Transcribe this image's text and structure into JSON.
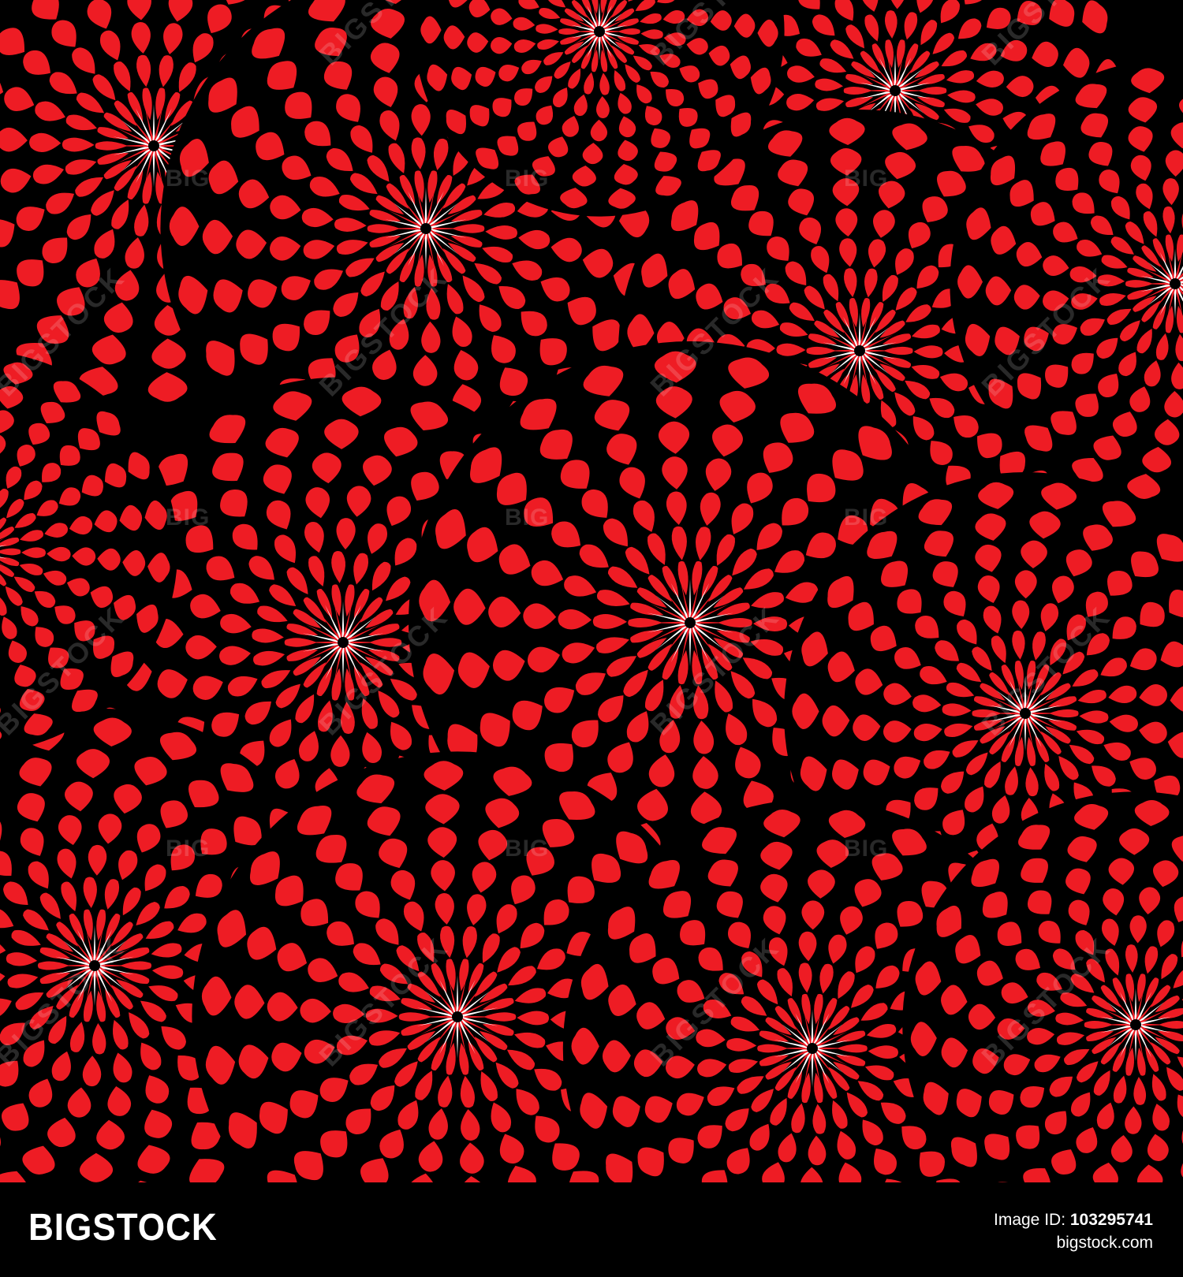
{
  "colors": {
    "petal": "#ee1c24",
    "background": "#000000",
    "footer_background": "#000000",
    "footer_text": "#ffffff"
  },
  "pattern": {
    "description_icon": "red-chrysanthemum-flower-icon"
  },
  "watermark": {
    "short_text": "BIG",
    "long_text": "BIGSTOCK"
  },
  "footer": {
    "brand": "BIGSTOCK",
    "image_id_label": "Image ID: ",
    "image_id_value": "103295741",
    "site_url": "bigstock.com"
  }
}
